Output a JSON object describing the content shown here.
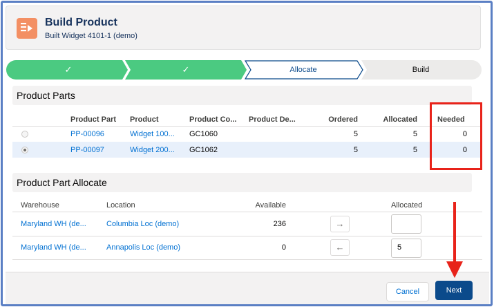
{
  "header": {
    "title": "Build Product",
    "subtitle": "Built Widget 4101-1 (demo)"
  },
  "path": {
    "steps": [
      {
        "label": "✓",
        "state": "complete"
      },
      {
        "label": "✓",
        "state": "complete"
      },
      {
        "label": "Allocate",
        "state": "current"
      },
      {
        "label": "Build",
        "state": "incomplete"
      }
    ]
  },
  "product_parts": {
    "heading": "Product Parts",
    "columns": [
      "Product Part",
      "Product",
      "Product Co...",
      "Product De...",
      "Ordered",
      "Allocated",
      "Needed"
    ],
    "rows": [
      {
        "part": "PP-00096",
        "product": "Widget 100...",
        "code": "GC1060",
        "desc": "",
        "ordered": "5",
        "allocated": "5",
        "needed": "0",
        "selected": false
      },
      {
        "part": "PP-00097",
        "product": "Widget 200...",
        "code": "GC1062",
        "desc": "",
        "ordered": "5",
        "allocated": "5",
        "needed": "0",
        "selected": true
      }
    ]
  },
  "allocate": {
    "heading": "Product Part Allocate",
    "columns": [
      "Warehouse",
      "Location",
      "Available",
      "Allocated"
    ],
    "rows": [
      {
        "warehouse": "Maryland WH (de...",
        "location": "Columbia Loc (demo)",
        "available": "236",
        "arrow": "→",
        "allocated": ""
      },
      {
        "warehouse": "Maryland WH (de...",
        "location": "Annapolis Loc (demo)",
        "available": "0",
        "arrow": "←",
        "allocated": "5"
      }
    ]
  },
  "footer": {
    "cancel_label": "Cancel",
    "next_label": "Next"
  },
  "colors": {
    "complete": "#4bca81",
    "brand": "#0b4a8b",
    "link": "#0070d2",
    "annotation": "#e8231a",
    "app_icon": "#f38f63"
  }
}
